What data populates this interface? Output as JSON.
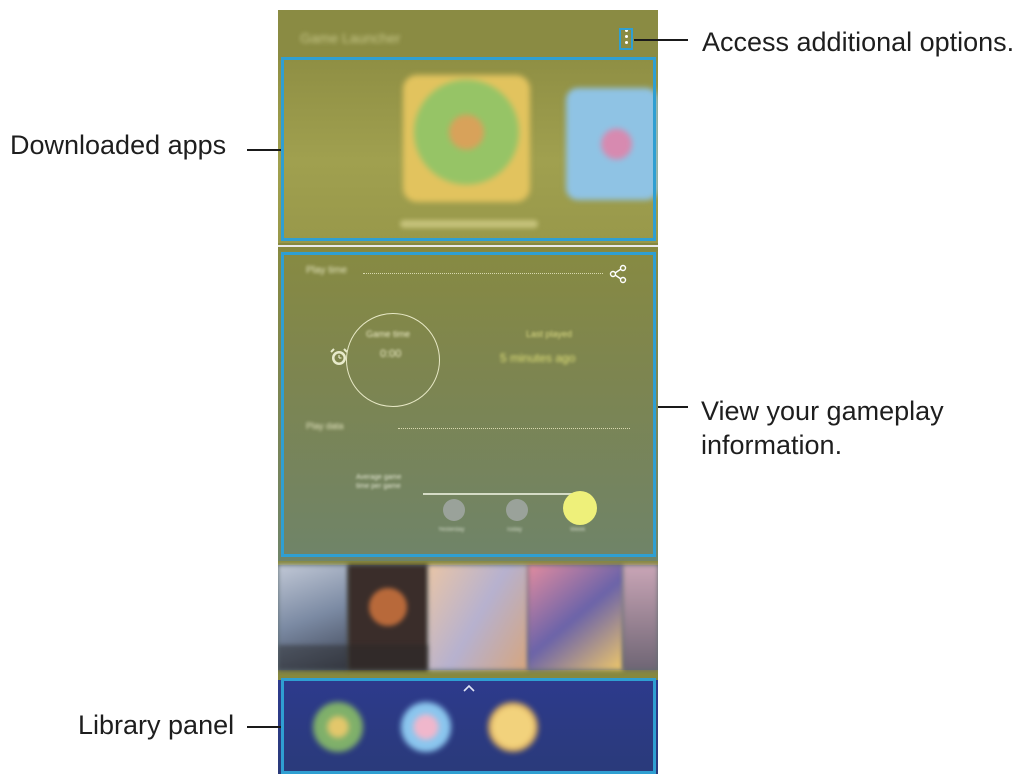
{
  "callouts": {
    "options": "Access additional options.",
    "downloaded": "Downloaded apps",
    "gameplay_line1": "View your gameplay",
    "gameplay_line2": "information.",
    "library": "Library panel"
  },
  "topbar": {
    "title": "Game Launcher",
    "more_icon": "more-options-icon"
  },
  "downloaded_apps": {
    "items": [
      {
        "name": "downloaded-game-1"
      },
      {
        "name": "downloaded-game-2"
      }
    ]
  },
  "gameplay": {
    "section_label": "Play time",
    "ring_title": "Game time",
    "ring_value": "0:00",
    "last_played_title": "Last played",
    "last_played_value": "5 minutes ago",
    "second_label": "Play data",
    "slider_caption": "Average game time per game",
    "knob_labels": [
      "Yesterday",
      "Today",
      "Week"
    ],
    "share_icon": "share-icon",
    "alarm_icon": "alarm-clock-icon"
  },
  "library": {
    "icons": [
      "library-game-1",
      "library-game-2",
      "library-game-3"
    ],
    "handle_icon": "chevron-up-icon"
  },
  "colors": {
    "highlight": "#2f9fd2",
    "panel_olive": "#86883f",
    "library_blue": "#2d3a8c",
    "accent_yellow": "#eef07a"
  }
}
